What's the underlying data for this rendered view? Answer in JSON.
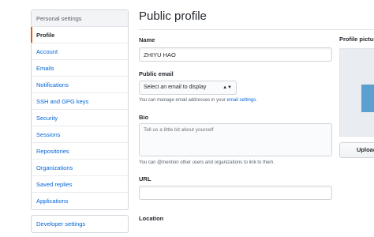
{
  "sidebar": {
    "header": "Personal settings",
    "items": [
      {
        "label": "Profile",
        "selected": true
      },
      {
        "label": "Account"
      },
      {
        "label": "Emails"
      },
      {
        "label": "Notifications"
      },
      {
        "label": "SSH and GPG keys"
      },
      {
        "label": "Security"
      },
      {
        "label": "Sessions"
      },
      {
        "label": "Repositories"
      },
      {
        "label": "Organizations"
      },
      {
        "label": "Saved replies"
      },
      {
        "label": "Applications"
      }
    ],
    "developer_settings": "Developer settings"
  },
  "main": {
    "title": "Public profile",
    "name": {
      "label": "Name",
      "value": "ZHIYU HAO"
    },
    "public_email": {
      "label": "Public email",
      "selected": "Select an email to display",
      "note_prefix": "You can manage email addresses in your",
      "note_link": "email settings",
      "note_suffix": "."
    },
    "bio": {
      "label": "Bio",
      "placeholder": "Tell us a little bit about yourself",
      "note": "You can @mention other users and organizations to link to them."
    },
    "url": {
      "label": "URL",
      "value": ""
    },
    "location": {
      "label": "Location"
    }
  },
  "profile_picture": {
    "label": "Profile picture",
    "upload_label": "Upload new picture"
  },
  "colors": {
    "link": "#0366d6",
    "selected_accent": "#e36209",
    "avatar_block": "#5c9fd1"
  }
}
